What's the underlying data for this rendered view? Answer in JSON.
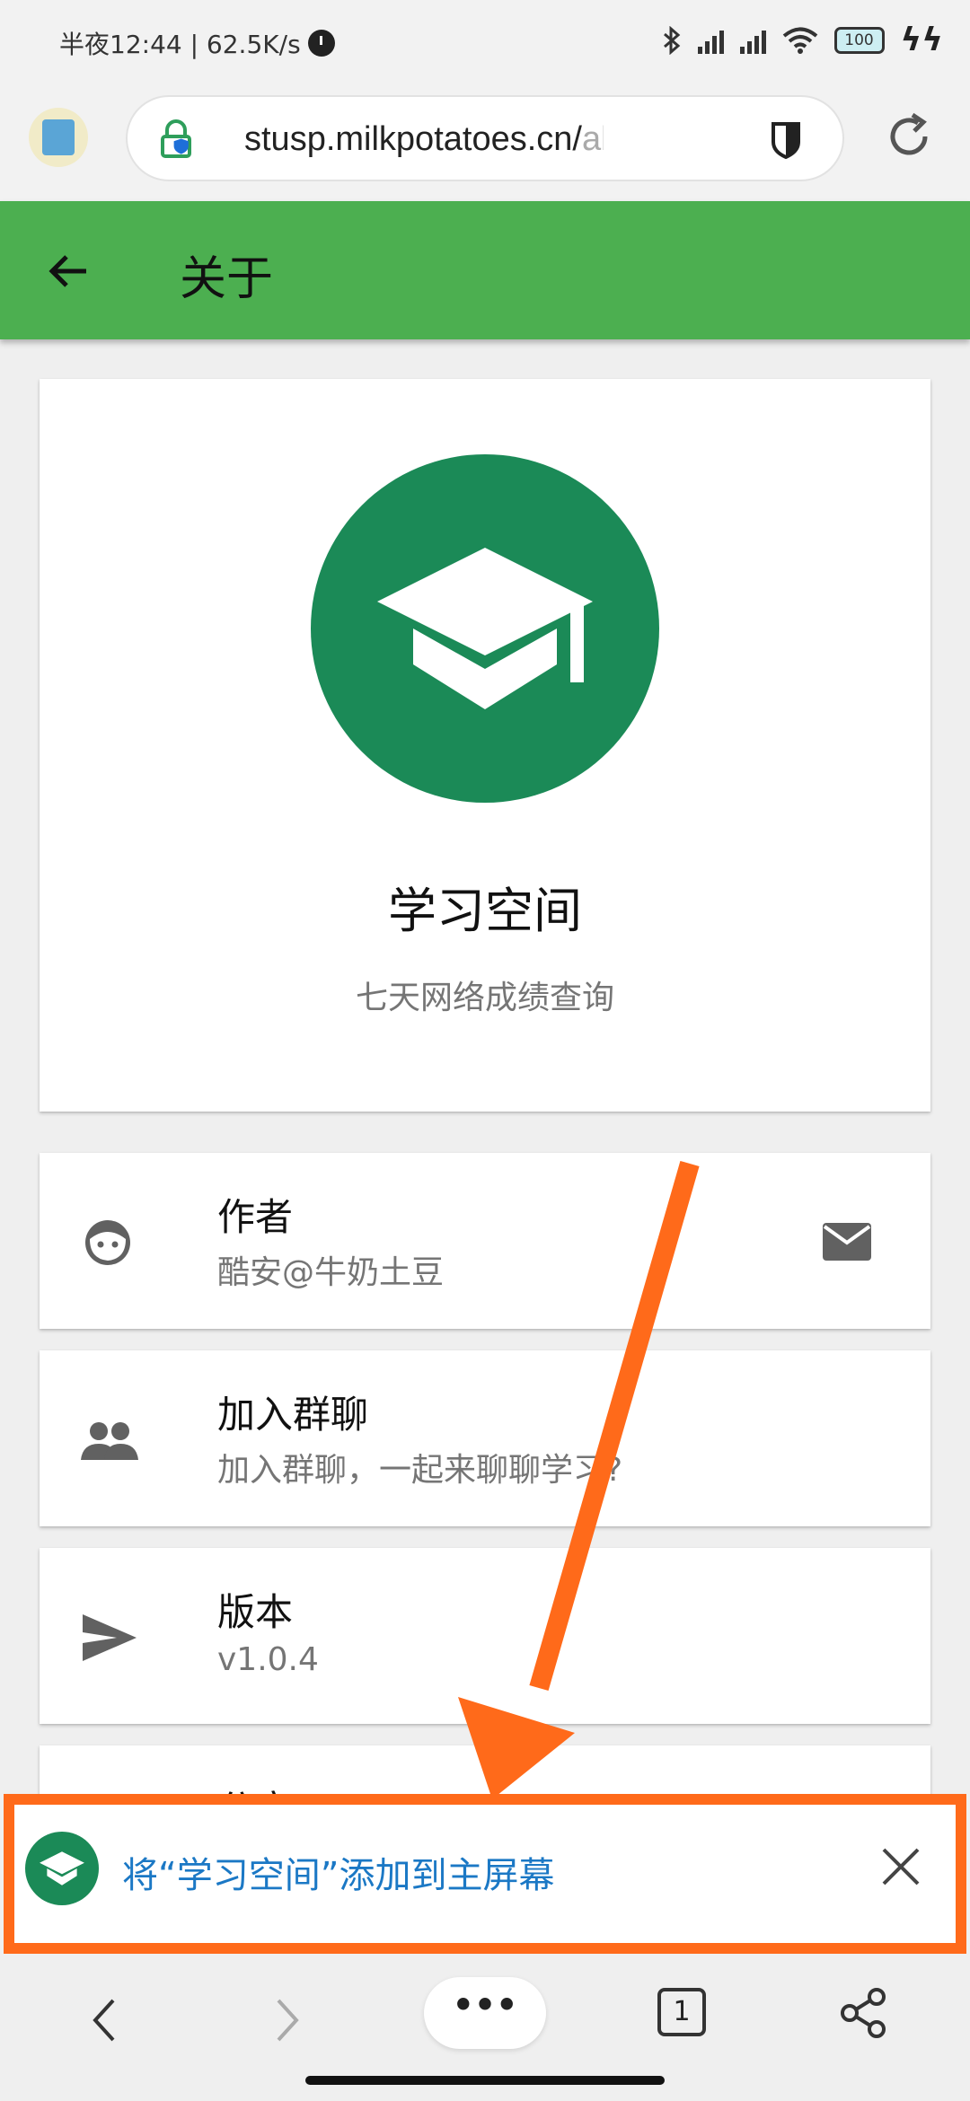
{
  "status_bar": {
    "text": "半夜12:44 | 62.5K/s",
    "battery": "100",
    "icons": [
      "alarm-icon",
      "bluetooth-icon",
      "signal-icon",
      "signal-icon",
      "wifi-icon",
      "battery-icon",
      "charging-icon"
    ]
  },
  "browser": {
    "url_main": "stusp.milkpotatoes.cn/",
    "url_tail": "abou",
    "icons": [
      "site-favicon",
      "lock-icon",
      "shield-icon",
      "reload-icon"
    ]
  },
  "appbar": {
    "title": "关于",
    "back_icon": "arrow-left-icon"
  },
  "hero": {
    "app_name": "学习空间",
    "subtitle": "七天网络成绩查询",
    "logo_icon": "graduation-cap-icon"
  },
  "items": {
    "author": {
      "title": "作者",
      "subtitle": "酷安@牛奶土豆",
      "icon": "face-icon",
      "action_icon": "mail-icon"
    },
    "group": {
      "title": "加入群聊",
      "subtitle": "加入群聊，一起来聊聊学习?",
      "icon": "people-icon"
    },
    "version": {
      "title": "版本",
      "subtitle": "v1.0.4",
      "icon": "send-icon"
    },
    "share": {
      "title": "分享"
    }
  },
  "banner": {
    "text": "将“学习空间”添加到主屏幕",
    "close_icon": "close-icon",
    "highlight_color": "#ff6a1a"
  },
  "bottom_nav": {
    "menu_label": "•••",
    "tab_count": "1",
    "icons": [
      "back-icon",
      "forward-icon",
      "menu-icon",
      "tabs-icon",
      "share-icon"
    ]
  },
  "colors": {
    "appbar": "#4caf50",
    "brand": "#1b8a57",
    "link": "#1b78c5",
    "annotation": "#ff6a1a"
  }
}
